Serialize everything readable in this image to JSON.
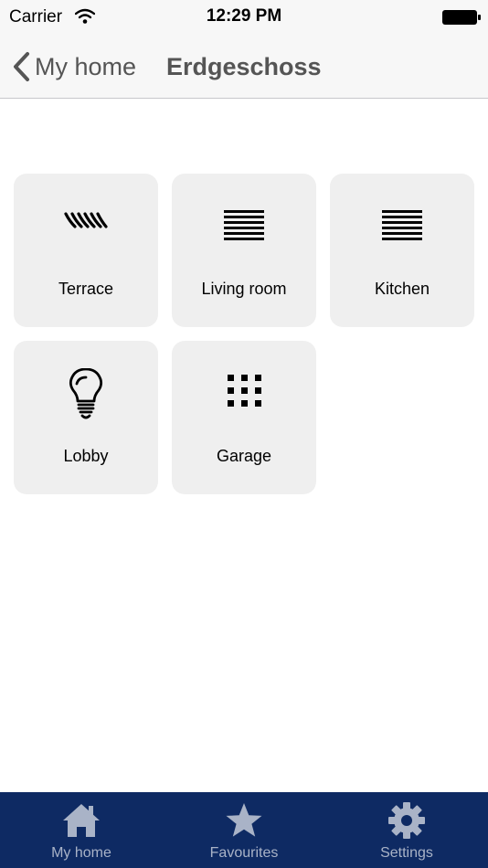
{
  "status_bar": {
    "carrier": "Carrier",
    "time": "12:29 PM"
  },
  "nav": {
    "back_label": "My home",
    "title": "Erdgeschoss"
  },
  "rooms": [
    {
      "label": "Terrace",
      "icon": "awning-icon"
    },
    {
      "label": "Living room",
      "icon": "blinds-icon"
    },
    {
      "label": "Kitchen",
      "icon": "blinds-icon"
    },
    {
      "label": "Lobby",
      "icon": "light-bulb-icon"
    },
    {
      "label": "Garage",
      "icon": "grid-dots-icon"
    }
  ],
  "tab_bar": {
    "items": [
      {
        "label": "My home",
        "icon": "home-icon"
      },
      {
        "label": "Favourites",
        "icon": "star-icon"
      },
      {
        "label": "Settings",
        "icon": "gear-icon"
      }
    ]
  },
  "colors": {
    "tab_bar_bg": "#0e2a63",
    "tab_inactive": "#a9b3c7",
    "tile_bg": "#efefef"
  }
}
